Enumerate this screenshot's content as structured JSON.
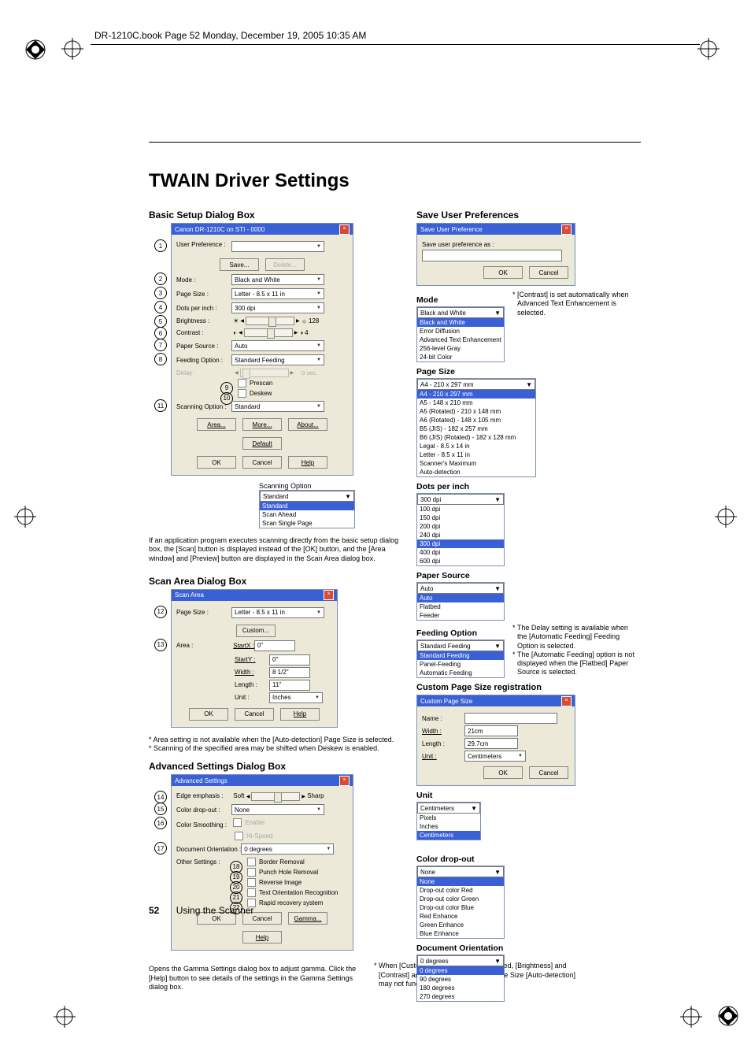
{
  "header_text": "DR-1210C.book  Page 52  Monday, December 19, 2005  10:35 AM",
  "title": "TWAIN Driver Settings",
  "footer": {
    "page": "52",
    "section": "Using the Scanner"
  },
  "basic": {
    "heading": "Basic Setup Dialog Box",
    "window_title": "Canon DR-1210C on STI - 0000",
    "user_pref_label": "User Preference :",
    "save": "Save...",
    "delete": "Delete...",
    "mode_label": "Mode :",
    "mode_value": "Black and White",
    "page_size_label": "Page Size :",
    "page_size_value": "Letter - 8.5 x 11 in",
    "dpi_label": "Dots per inch :",
    "dpi_value": "300 dpi",
    "bright_label": "Brightness :",
    "bright_val": "128",
    "contrast_label": "Contrast :",
    "contrast_val": "4",
    "paper_source_label": "Paper Source :",
    "paper_source_value": "Auto",
    "feeding_label": "Feeding Option :",
    "feeding_value": "Standard Feeding",
    "delay_label": "Delay :",
    "delay_unit": "0 sec.",
    "prescan": "Prescan",
    "deskew": "Deskew",
    "scan_opt_label": "Scanning Option :",
    "scan_opt_value": "Standard",
    "area_btn": "Area...",
    "more_btn": "More...",
    "about_btn": "About...",
    "default_btn": "Default",
    "ok": "OK",
    "cancel": "Cancel",
    "help": "Help",
    "scan_opt_heading": "Scanning Option",
    "scan_opt_dd": {
      "sel": "Standard",
      "opts": [
        "Standard",
        "Scan Ahead",
        "Scan Single Page"
      ]
    },
    "para": "If an application program executes scanning directly from the basic setup dialog box, the [Scan] button is displayed instead of the [OK] button, and the [Area window] and [Preview] button are displayed in the Scan Area dialog box."
  },
  "scanArea": {
    "heading": "Scan Area Dialog Box",
    "window_title": "Scan Area",
    "page_size_label": "Page Size :",
    "page_size_value": "Letter - 8.5 x 11 in",
    "custom": "Custom...",
    "area_label": "Area :",
    "startx_l": "StartX :",
    "startx_v": "0\"",
    "starty_l": "StartY :",
    "starty_v": "0\"",
    "width_l": "Width :",
    "width_v": "8 1/2\"",
    "length_l": "Length :",
    "length_v": "11\"",
    "unit_l": "Unit :",
    "unit_v": "Inches",
    "ok": "OK",
    "cancel": "Cancel",
    "help": "Help",
    "n1": "* Area setting is not available when the [Auto-detection] Page Size is selected.",
    "n2": "* Scanning of the specified area may be shifted when Deskew is enabled."
  },
  "advanced": {
    "heading": "Advanced Settings Dialog Box",
    "window_title": "Advanced Settings",
    "edge_label": "Edge emphasis :",
    "edge_left": "Soft",
    "edge_right": "Sharp",
    "drop_label": "Color drop-out :",
    "drop_value": "None",
    "smooth_label": "Color Smoothing :",
    "smooth_en": "Enable",
    "smooth_hq": "Hi-Speed",
    "orient_label": "Document Orientation :",
    "orient_value": "0 degrees",
    "other_label": "Other Settings :",
    "o_border": "Border Removal",
    "o_punch": "Punch Hole Removal",
    "o_rev": "Reverse Image",
    "o_text": "Text Orientation Recognition",
    "o_rapid": "Rapid recovery system",
    "ok": "OK",
    "cancel": "Cancel",
    "gamma": "Gamma...",
    "help": "Help",
    "gamma_note": "Opens the Gamma Settings dialog box to adjust gamma. Click the [Help] button to see details of the settings in the Gamma Settings dialog box.",
    "custom_note": "* When [Custom] gamma setting is selected, [Brightness] and [Contrast] are set automatically, but Page Size [Auto-detection] may not function normally."
  },
  "right": {
    "save_pref": {
      "heading": "Save User Preferences",
      "title": "Save User Preference",
      "label": "Save user preference as :",
      "ok": "OK",
      "cancel": "Cancel"
    },
    "mode": {
      "heading": "Mode",
      "sel": "Black and White",
      "opts": [
        "Black and White",
        "Error Diffusion",
        "Advanced Text Enhancement",
        "256-level Gray",
        "24-bit Color"
      ],
      "note": "* [Contrast] is set automatically when Advanced Text Enhancement is selected."
    },
    "page_size": {
      "heading": "Page Size",
      "sel": "A4 - 210 x 297 mm",
      "opts": [
        "A4 - 210 x 297 mm",
        "A5 - 148 x 210 mm",
        "A5 (Rotated) - 210 x 148 mm",
        "A6 (Rotated) - 148 x 105 mm",
        "B5 (JIS) - 182 x 257 mm",
        "B6 (JIS) (Rotated) - 182 x 128 mm",
        "Legal - 8.5 x 14 in",
        "Letter - 8.5 x 11 in",
        "Scanner's Maximum",
        "Auto-detection"
      ]
    },
    "dpi": {
      "heading": "Dots per inch",
      "sel": "300 dpi",
      "opts": [
        "100 dpi",
        "150 dpi",
        "200 dpi",
        "240 dpi",
        "300 dpi",
        "400 dpi",
        "600 dpi"
      ]
    },
    "paper_source": {
      "heading": "Paper Source",
      "sel": "Auto",
      "opts": [
        "Auto",
        "Flatbed",
        "Feeder"
      ]
    },
    "feeding": {
      "heading": "Feeding Option",
      "sel": "Standard Feeding",
      "opts": [
        "Standard Feeding",
        "Panel-Feeding",
        "Automatic Feeding"
      ],
      "note1": "* The Delay setting is available when the [Automatic Feeding] Feeding Option is selected.",
      "note2": "* The [Automatic Feeding] option is not displayed when the [Flatbed] Paper Source is selected."
    },
    "custom_page": {
      "heading": "Custom Page Size registration",
      "title": "Custom Page Size",
      "name_l": "Name :",
      "width_l": "Width :",
      "width_v": "21cm",
      "length_l": "Length :",
      "length_v": "29.7cm",
      "unit_l": "Unit :",
      "unit_v": "Centimeters",
      "ok": "OK",
      "cancel": "Cancel"
    },
    "unit": {
      "heading": "Unit",
      "sel": "Centimeters",
      "opts": [
        "Pixels",
        "Inches",
        "Centimeters"
      ]
    },
    "dropout": {
      "heading": "Color drop-out",
      "sel": "None",
      "opts": [
        "None",
        "Drop-out color Red",
        "Drop-out color Green",
        "Drop-out color Blue",
        "Red Enhance",
        "Green Enhance",
        "Blue Enhance"
      ]
    },
    "orient": {
      "heading": "Document Orientation",
      "sel": "0 degrees",
      "opts": [
        "0 degrees",
        "90 degrees",
        "180 degrees",
        "270 degrees"
      ]
    }
  },
  "circled": {
    "1": "1",
    "2": "2",
    "3": "3",
    "4": "4",
    "5": "5",
    "6": "6",
    "7": "7",
    "8": "8",
    "9": "9",
    "10": "10",
    "11": "11",
    "12": "12",
    "13": "13",
    "14": "14",
    "15": "15",
    "16": "16",
    "17": "17",
    "18": "18",
    "19": "19",
    "20": "20",
    "21": "21",
    "22": "22"
  }
}
